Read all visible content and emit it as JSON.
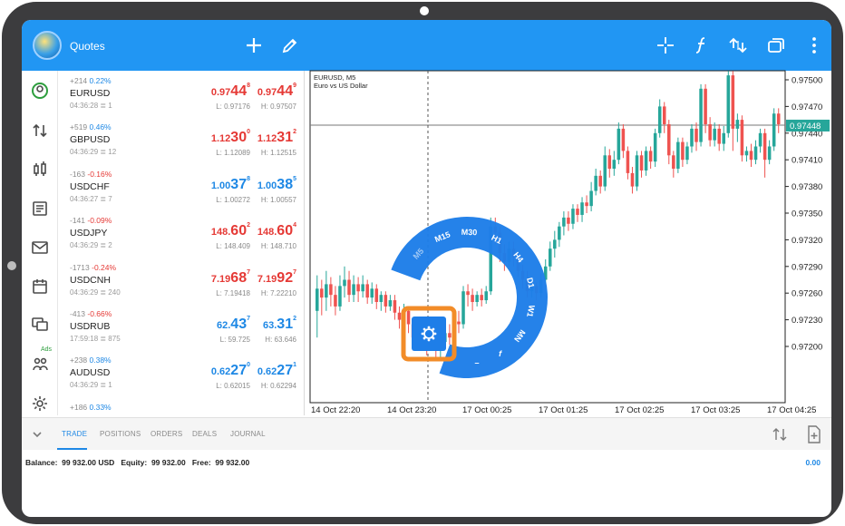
{
  "appbar": {
    "title": "Quotes",
    "icons": [
      "add-icon",
      "pencil-icon",
      "crosshair-icon",
      "function-icon",
      "dollar-refresh-icon",
      "windows-icon",
      "more-vertical-icon"
    ]
  },
  "nav": {
    "active_label": "Ads"
  },
  "quotes": [
    {
      "chg_pts": "+214",
      "chg_pct": "0.22%",
      "symbol": "EURUSD",
      "time": "04:36:28",
      "spread": "1",
      "bid": {
        "pre": "0.97",
        "big": "44",
        "sup": "8"
      },
      "ask": {
        "pre": "0.97",
        "big": "44",
        "sup": "9"
      },
      "low": "L: 0.97176",
      "high": "H: 0.97507",
      "bid_color": "#e53935",
      "ask_color": "#e53935",
      "chg_color": "#1e88e5"
    },
    {
      "chg_pts": "+519",
      "chg_pct": "0.46%",
      "symbol": "GBPUSD",
      "time": "04:36:29",
      "spread": "12",
      "bid": {
        "pre": "1.12",
        "big": "30",
        "sup": "0"
      },
      "ask": {
        "pre": "1.12",
        "big": "31",
        "sup": "2"
      },
      "low": "L: 1.12089",
      "high": "H: 1.12515",
      "bid_color": "#e53935",
      "ask_color": "#e53935",
      "chg_color": "#1e88e5"
    },
    {
      "chg_pts": "-163",
      "chg_pct": "-0.16%",
      "symbol": "USDCHF",
      "time": "04:36:27",
      "spread": "7",
      "bid": {
        "pre": "1.00",
        "big": "37",
        "sup": "8"
      },
      "ask": {
        "pre": "1.00",
        "big": "38",
        "sup": "5"
      },
      "low": "L: 1.00272",
      "high": "H: 1.00557",
      "bid_color": "#1e88e5",
      "ask_color": "#1e88e5",
      "chg_color": "#e53935"
    },
    {
      "chg_pts": "-141",
      "chg_pct": "-0.09%",
      "symbol": "USDJPY",
      "time": "04:36:29",
      "spread": "2",
      "bid": {
        "pre": "148.",
        "big": "60",
        "sup": "2"
      },
      "ask": {
        "pre": "148.",
        "big": "60",
        "sup": "4"
      },
      "low": "L: 148.409",
      "high": "H: 148.710",
      "bid_color": "#e53935",
      "ask_color": "#e53935",
      "chg_color": "#e53935"
    },
    {
      "chg_pts": "-1713",
      "chg_pct": "-0.24%",
      "symbol": "USDCNH",
      "time": "04:36:29",
      "spread": "240",
      "bid": {
        "pre": "7.19",
        "big": "68",
        "sup": "7"
      },
      "ask": {
        "pre": "7.19",
        "big": "92",
        "sup": "7"
      },
      "low": "L: 7.19418",
      "high": "H: 7.22210",
      "bid_color": "#e53935",
      "ask_color": "#e53935",
      "chg_color": "#e53935"
    },
    {
      "chg_pts": "-413",
      "chg_pct": "-0.66%",
      "symbol": "USDRUB",
      "time": "17:59:18",
      "spread": "875",
      "bid": {
        "pre": "62.",
        "big": "43",
        "sup": "7"
      },
      "ask": {
        "pre": "63.",
        "big": "31",
        "sup": "2"
      },
      "low": "L: 59.725",
      "high": "H: 63.646",
      "bid_color": "#1e88e5",
      "ask_color": "#1e88e5",
      "chg_color": "#e53935"
    },
    {
      "chg_pts": "+238",
      "chg_pct": "0.38%",
      "symbol": "AUDUSD",
      "time": "04:36:29",
      "spread": "1",
      "bid": {
        "pre": "0.62",
        "big": "27",
        "sup": "0"
      },
      "ask": {
        "pre": "0.62",
        "big": "27",
        "sup": "1"
      },
      "low": "L: 0.62015",
      "high": "H: 0.62294",
      "bid_color": "#1e88e5",
      "ask_color": "#1e88e5",
      "chg_color": "#1e88e5"
    },
    {
      "chg_pts": "+186",
      "chg_pct": "0.33%",
      "symbol": "",
      "time": "",
      "spread": "",
      "bid": {
        "pre": "",
        "big": "",
        "sup": ""
      },
      "ask": {
        "pre": "",
        "big": "",
        "sup": ""
      },
      "low": "",
      "high": "",
      "bid_color": "#1e88e5",
      "ask_color": "#e53935",
      "chg_color": "#1e88e5"
    }
  ],
  "chart": {
    "symbol_line": "EURUSD, M5",
    "description": "Euro vs US Dollar",
    "price_ticks": [
      "0.97500",
      "0.97470",
      "0.97440",
      "0.97410",
      "0.97380",
      "0.97350",
      "0.97320",
      "0.97290",
      "0.97260",
      "0.97230",
      "0.97200"
    ],
    "current_price": "0.97448",
    "time_ticks": [
      "14 Oct 22:20",
      "14 Oct 23:20",
      "17 Oct 00:25",
      "17 Oct 01:25",
      "17 Oct 02:25",
      "17 Oct 03:25",
      "17 Oct 04:25"
    ],
    "bull_color": "#26a69a",
    "bear_color": "#ef5350"
  },
  "timeframes": [
    "M1",
    "M5",
    "M15",
    "M30",
    "H1",
    "H4",
    "D1",
    "W1",
    "MN"
  ],
  "ring_tools": [
    "settings-icon",
    "minus-icon",
    "function-icon"
  ],
  "bottom_tabs": [
    "TRADE",
    "POSITIONS",
    "ORDERS",
    "DEALS",
    "JOURNAL"
  ],
  "balance": {
    "balance_label": "Balance:",
    "balance_value": "99 932.00 USD",
    "equity_label": "Equity:",
    "equity_value": "99 932.00",
    "free_label": "Free:",
    "free_value": "99 932.00",
    "profit": "0.00"
  }
}
